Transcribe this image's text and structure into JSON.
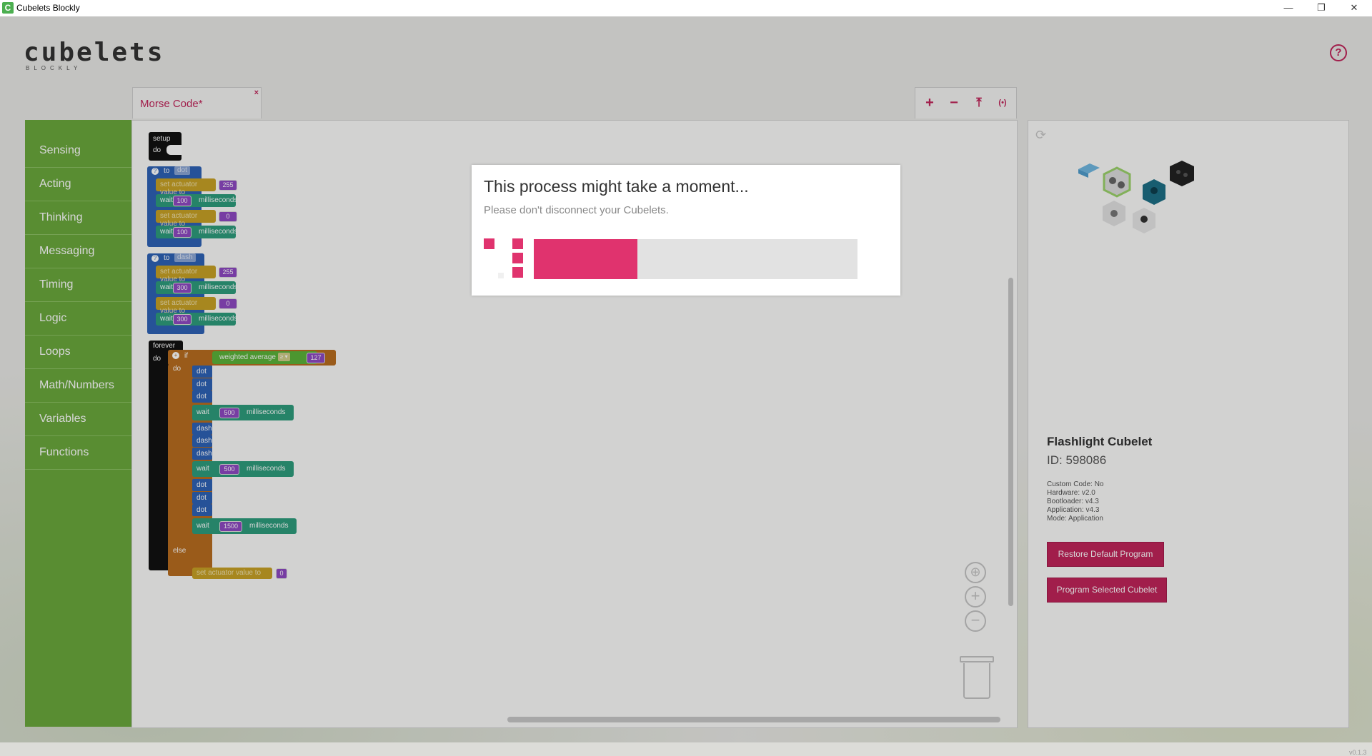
{
  "window": {
    "title": "Cubelets Blockly",
    "minimize": "—",
    "restore": "❐",
    "close": "✕"
  },
  "app": {
    "logo": "cubelets",
    "logo_sub": "BLOCKLY",
    "help": "?",
    "version": "v0.1.3"
  },
  "tabs": [
    {
      "label": "Morse Code*",
      "close": "×"
    }
  ],
  "workspace_tools": [
    {
      "icon": "plus-icon",
      "glyph": "+"
    },
    {
      "icon": "minus-icon",
      "glyph": "−"
    },
    {
      "icon": "upload-icon",
      "glyph": "⤒"
    },
    {
      "icon": "broadcast-icon",
      "glyph": "(•)"
    }
  ],
  "sidebar": {
    "categories": [
      "Sensing",
      "Acting",
      "Thinking",
      "Messaging",
      "Timing",
      "Logic",
      "Loops",
      "Math/Numbers",
      "Variables",
      "Functions"
    ]
  },
  "blocks": {
    "setup": {
      "title": "setup",
      "do": "do"
    },
    "dot_fn": {
      "header": "to",
      "name": "dot",
      "rows": [
        {
          "kind": "set",
          "label": "set actuator value to",
          "value": "255"
        },
        {
          "kind": "wait",
          "label": "wait",
          "value": "100",
          "unit": "milliseconds"
        },
        {
          "kind": "set",
          "label": "set actuator value to",
          "value": "0"
        },
        {
          "kind": "wait",
          "label": "wait",
          "value": "100",
          "unit": "milliseconds"
        }
      ]
    },
    "dash_fn": {
      "header": "to",
      "name": "dash",
      "rows": [
        {
          "kind": "set",
          "label": "set actuator value to",
          "value": "255"
        },
        {
          "kind": "wait",
          "label": "wait",
          "value": "300",
          "unit": "milliseconds"
        },
        {
          "kind": "set",
          "label": "set actuator value to",
          "value": "0"
        },
        {
          "kind": "wait",
          "label": "wait",
          "value": "300",
          "unit": "milliseconds"
        }
      ]
    },
    "forever": {
      "title": "forever",
      "do": "do",
      "if": "if",
      "inner_do": "do",
      "else": "else",
      "condition": {
        "label": "weighted average",
        "op": "≥ ▾",
        "value": "127"
      },
      "calls": [
        "dot",
        "dot",
        "dot",
        "dash",
        "dash",
        "dash",
        "dot",
        "dot",
        "dot"
      ],
      "waits": [
        {
          "label": "wait",
          "value": "500",
          "unit": "milliseconds"
        },
        {
          "label": "wait",
          "value": "500",
          "unit": "milliseconds"
        },
        {
          "label": "wait",
          "value": "1500",
          "unit": "milliseconds"
        }
      ],
      "else_block": {
        "label": "set actuator value to",
        "value": "0"
      }
    }
  },
  "workspace_controls": {
    "center": "⊕",
    "zoom_in": "+",
    "zoom_out": "−"
  },
  "cubelet_panel": {
    "refresh": "⟳",
    "name": "Flashlight Cubelet",
    "id": "ID: 598086",
    "info": [
      "Custom Code: No",
      "Hardware: v2.0",
      "Bootloader: v4.3",
      "Application: v4.3",
      "Mode: Application"
    ],
    "restore_button": "Restore Default Program",
    "program_button": "Program Selected Cubelet"
  },
  "modal": {
    "title": "This process might take a moment...",
    "subtitle": "Please don't disconnect your Cubelets.",
    "progress": 0.32,
    "accent": "#e0336e"
  }
}
